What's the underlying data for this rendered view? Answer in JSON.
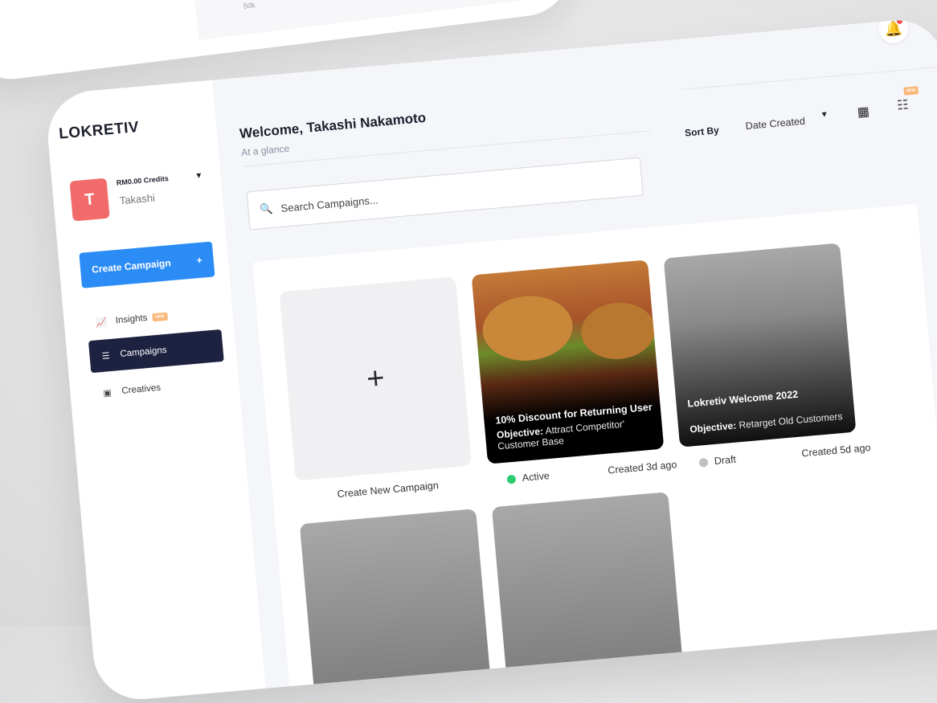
{
  "background_chart": {
    "tick": "50k"
  },
  "app": {
    "logo": "LOKRETIV"
  },
  "account": {
    "avatar_initial": "T",
    "credits": "RM0.00 Credits",
    "name": "Takashi"
  },
  "sidebar": {
    "create_button": "Create Campaign",
    "create_plus": "+",
    "items": [
      {
        "label": "Insights",
        "badge": "NEW"
      },
      {
        "label": "Campaigns"
      },
      {
        "label": "Creatives"
      }
    ]
  },
  "header": {
    "welcome": "Welcome, Takashi Nakamoto",
    "subtitle": "At a glance",
    "sort_label": "Sort By",
    "sort_value": "Date Created",
    "list_badge": "NEW"
  },
  "search": {
    "placeholder": "Search Campaigns..."
  },
  "campaigns": {
    "create_card": {
      "plus": "+",
      "caption": "Create New Campaign"
    },
    "items": [
      {
        "title": "10% Discount for Returning User",
        "objective_label": "Objective:",
        "objective": "Attract Competitor' Customer Base",
        "status": "Active",
        "status_color": "#2ecc71",
        "created": "Created 3d ago"
      },
      {
        "title": "Lokretiv Welcome 2022",
        "objective_label": "Objective:",
        "objective": "Retarget Old Customers",
        "status": "Draft",
        "status_color": "#bfc0c4",
        "created": "Created 5d ago"
      }
    ]
  },
  "colors": {
    "accent": "#2b8cf6",
    "nav_active": "#1e2241",
    "avatar": "#f26b6b"
  }
}
